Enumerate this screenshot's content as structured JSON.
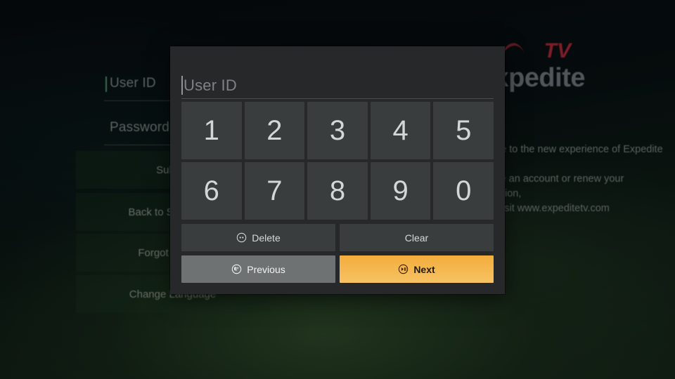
{
  "background": {
    "login": {
      "user_id_label": "User ID",
      "password_label": "Password",
      "buttons": [
        {
          "label": "Submit",
          "name": "submit"
        },
        {
          "label": "Back to Server List",
          "name": "back-to-server-list"
        },
        {
          "label": "Forgot User ID",
          "name": "forgot-user-id"
        },
        {
          "label": "Change Language",
          "name": "change-language"
        }
      ]
    },
    "logo": {
      "word": "Expedite",
      "suffix": "TV"
    },
    "promo_lines": [
      "Welcome to the new experience of Expedite TV !",
      "To create an account or renew your subscription,",
      "please visit www.expeditetv.com"
    ]
  },
  "dialog": {
    "input": {
      "value": "",
      "placeholder": "User ID"
    },
    "keys": [
      "1",
      "2",
      "3",
      "4",
      "5",
      "6",
      "7",
      "8",
      "9",
      "0"
    ],
    "actions": {
      "delete": {
        "label": "Delete",
        "icon": "rewind-circle-icon"
      },
      "clear": {
        "label": "Clear",
        "icon": "none"
      },
      "previous": {
        "label": "Previous",
        "icon": "back-arrow-circle-icon",
        "focused": true
      },
      "next": {
        "label": "Next",
        "icon": "play-pause-circle-icon",
        "accent": true
      }
    }
  },
  "colors": {
    "dialog_bg": "#262829",
    "key_bg": "#3a3d3e",
    "accent": "#f3ad3c",
    "focus_gray": "#6f7273",
    "logo_red": "#7c1d28"
  }
}
